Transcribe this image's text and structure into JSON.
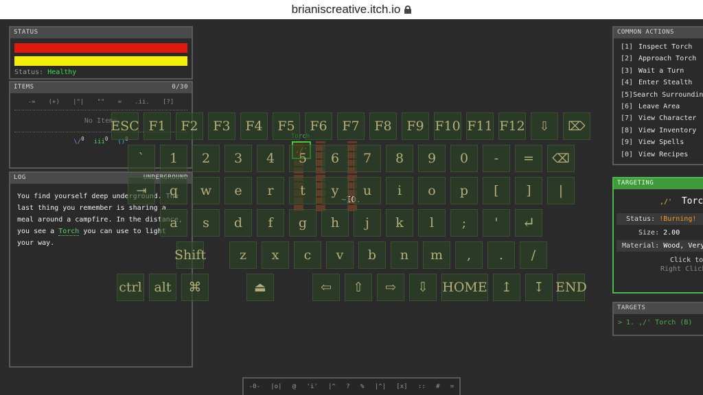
{
  "browser": {
    "url": "brianiscreative.itch.io"
  },
  "status_panel": {
    "title": "STATUS",
    "status_label": "Status:",
    "status_value": "Healthy",
    "colors": {
      "health": "#e0190f",
      "energy": "#f3ef08",
      "healthy": "#3ddc52"
    }
  },
  "items_panel": {
    "title": "ITEMS",
    "count": "0/30",
    "filters": [
      "-=",
      "(+)",
      "|\"|",
      "\"\"",
      "=",
      ".ii.",
      "[?]"
    ],
    "empty_text": "No Items",
    "currencies": [
      {
        "glyph": "\\/",
        "value": "0",
        "color": "#c86ae0"
      },
      {
        "glyph": "iii",
        "value": "0",
        "color": "#4fd45a"
      },
      {
        "glyph": "()",
        "value": "0",
        "color": "#38b4e8"
      }
    ]
  },
  "log_panel": {
    "title": "LOG",
    "tag": "UNDERGROUND",
    "message": {
      "before": "You find yourself deep underground. The last thing you remember is sharing a meal around a campfire. In the distance, you see a ",
      "highlight": "Torch",
      "after": " you can use to light your way."
    }
  },
  "common_actions": {
    "title": "COMMON ACTIONS",
    "items": [
      {
        "key": "[1]",
        "label": "Inspect Torch"
      },
      {
        "key": "[2]",
        "label": "Approach Torch"
      },
      {
        "key": "[3]",
        "label": "Wait a Turn"
      },
      {
        "key": "[4]",
        "label": "Enter Stealth"
      },
      {
        "key": "[5]",
        "label": "Search Surroundings"
      },
      {
        "key": "[6]",
        "label": "Leave Area"
      },
      {
        "key": "[7]",
        "label": "View Character"
      },
      {
        "key": "[8]",
        "label": "View Inventory"
      },
      {
        "key": "[9]",
        "label": "View Spells"
      },
      {
        "key": "[0]",
        "label": "View Recipes"
      }
    ]
  },
  "targeting": {
    "title": "TARGETING",
    "glyph": ",/'",
    "name": "Torch",
    "status_label": "Status:",
    "status_value": "!Burning!",
    "size_label": "Size:",
    "size_value": "2.00",
    "material_label": "Material:",
    "material_value": "Wood, Very",
    "hint1": "Click to m",
    "hint2": "Right Click"
  },
  "targets": {
    "title": "TARGETS",
    "entry": "> 1. ,/' Torch (B)"
  },
  "game": {
    "torch_label": "Torch",
    "torch_glyph": ",/'",
    "player_glyph": "~IO."
  },
  "keyboard": {
    "row_fn": [
      "ESC",
      "F1",
      "F2",
      "F3",
      "F4",
      "F5",
      "F6",
      "F7",
      "F8",
      "F9",
      "F10",
      "F11",
      "F12",
      "⇩",
      "⌦"
    ],
    "row_num": [
      "`",
      "1",
      "2",
      "3",
      "4",
      "5",
      "6",
      "7",
      "8",
      "9",
      "0",
      "-",
      "=",
      "⌫"
    ],
    "row_q": [
      "⇥",
      "q",
      "w",
      "e",
      "r",
      "t",
      "y",
      "u",
      "i",
      "o",
      "p",
      "[",
      "]",
      "|"
    ],
    "row_a": [
      "a",
      "s",
      "d",
      "f",
      "g",
      "h",
      "j",
      "k",
      "l",
      ";",
      "'",
      "↵"
    ],
    "row_z": [
      "Shift",
      "z",
      "x",
      "c",
      "v",
      "b",
      "n",
      "m",
      ",",
      ".",
      "/"
    ],
    "row_bottom": [
      "ctrl",
      "alt",
      "⌘",
      "⏏",
      "⇦",
      "⇧",
      "⇨",
      "⇩",
      "HOME",
      "↥",
      "↧",
      "END"
    ]
  },
  "bottom_bar": {
    "icons": [
      "-0-",
      "|o|",
      "@",
      "'i'",
      "|^",
      "?",
      "%",
      "|^|",
      "[x]",
      "::",
      "#",
      "="
    ]
  }
}
